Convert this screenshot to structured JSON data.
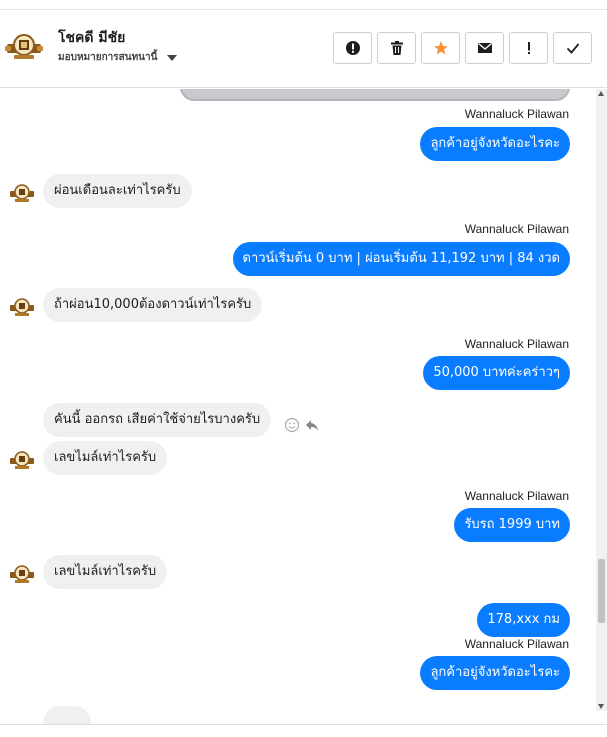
{
  "header": {
    "title": "โชคดี มีชัย",
    "subtitle": "มอบหมายการสนทนานี้",
    "actions": [
      {
        "name": "spam-button",
        "icon": "alert-circle-icon"
      },
      {
        "name": "delete-button",
        "icon": "trash-icon"
      },
      {
        "name": "star-button",
        "icon": "star-icon"
      },
      {
        "name": "mark-unread-button",
        "icon": "envelope-icon"
      },
      {
        "name": "follow-up-button",
        "icon": "exclamation-icon"
      },
      {
        "name": "done-button",
        "icon": "check-icon"
      }
    ]
  },
  "messages": {
    "m1_sender": "Wannaluck Pilawan",
    "m1_text": "ลูกค้าอยู่จังหวัดอะไรคะ",
    "m2_text": "ผ่อนเดือนละเท่าไรครับ",
    "m3_sender": "Wannaluck Pilawan",
    "m3_text": "ดาวน์เริ่มต้น 0 บาท | ผ่อนเริ่มต้น 11,192  บาท | 84 งวด",
    "m4_text": "ถ้าผ่อน10,000ต้องดาวน์เท่าไรครับ",
    "m5_sender": "Wannaluck Pilawan",
    "m5_text": "50,000 บาทค่ะคร่าวๆ",
    "m6_text": "คันนี้ ออกรถ เสียค่าใช้จ่ายไรบางครับ",
    "m7_text": "เลขไมล์เท่าไรครับ",
    "m8_sender": "Wannaluck Pilawan",
    "m8_text": "รับรถ 1999 บาท",
    "m9_text": "เลขไมล์เท่าไรครับ",
    "m10_text": "178,xxx กม",
    "m11_sender": "Wannaluck Pilawan",
    "m11_text": "ลูกค้าอยู่จังหวัดอะไรคะ"
  },
  "colors": {
    "outgoing_bubble": "#0a7cff",
    "incoming_bubble": "#f0f0f0",
    "star_accent": "#f7923b"
  }
}
